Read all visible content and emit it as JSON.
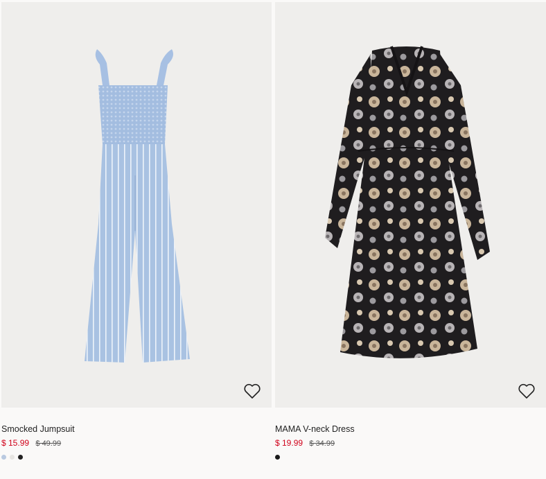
{
  "products": [
    {
      "title": "Smocked Jumpsuit",
      "sale_price": "$ 15.99",
      "original_price": "$ 49.99",
      "favorite_icon": "heart-outline-icon",
      "swatches": [
        "#b9c9e0",
        "#e7e5e2",
        "#222222"
      ]
    },
    {
      "title": "MAMA V-neck Dress",
      "sale_price": "$ 19.99",
      "original_price": "$ 34.99",
      "favorite_icon": "heart-outline-icon",
      "swatches": [
        "#1a1a1a"
      ]
    }
  ],
  "colors": {
    "sale": "#d0021b",
    "image_bg": "#efeeec",
    "page_bg": "#faf9f8"
  }
}
